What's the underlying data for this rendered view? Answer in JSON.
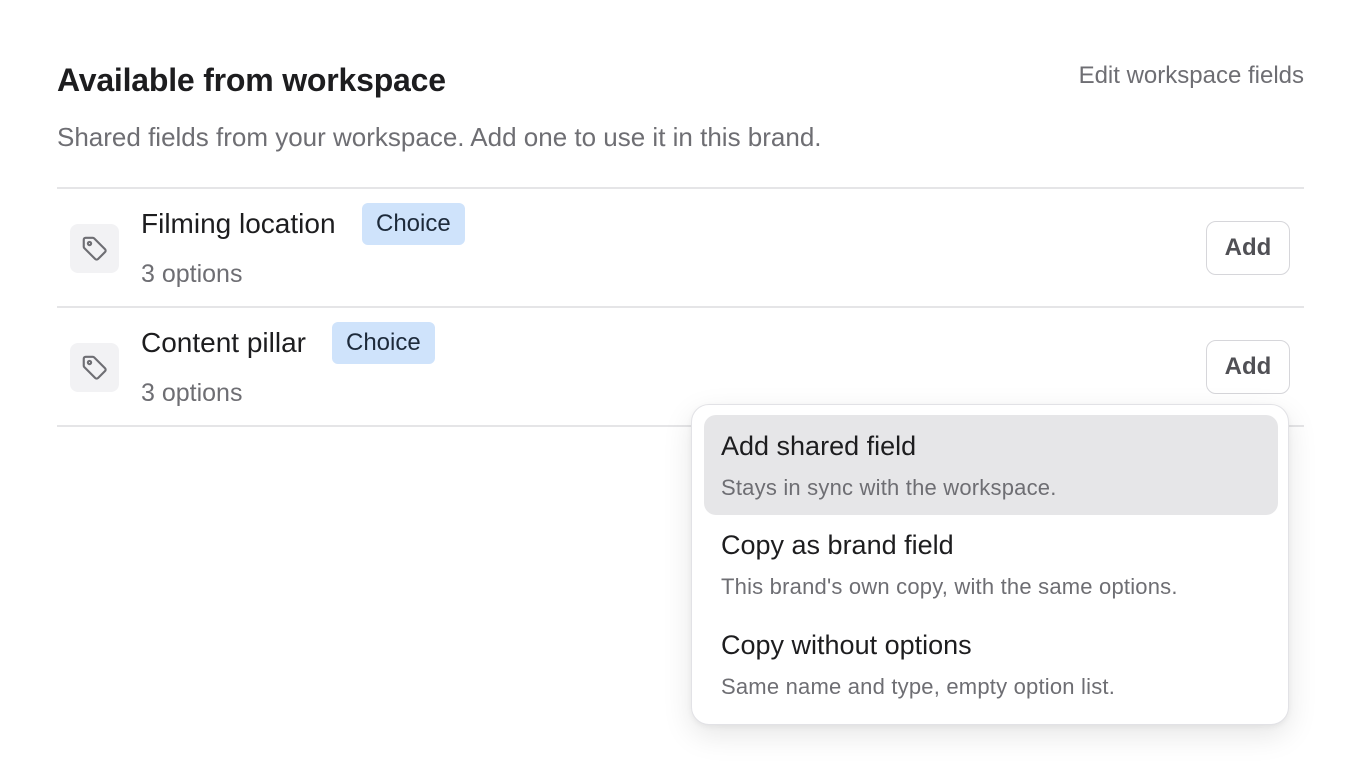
{
  "header": {
    "title": "Available from workspace",
    "edit_link": "Edit workspace fields",
    "subtitle": "Shared fields from your workspace. Add one to use it in this brand."
  },
  "fields": [
    {
      "name": "Filming location",
      "type_badge": "Choice",
      "meta": "3 options",
      "icon": "tag-icon",
      "add_label": "Add"
    },
    {
      "name": "Content pillar",
      "type_badge": "Choice",
      "meta": "3 options",
      "icon": "tag-icon",
      "add_label": "Add"
    }
  ],
  "add_menu": {
    "items": [
      {
        "title": "Add shared field",
        "description": "Stays in sync with the workspace.",
        "highlighted": true
      },
      {
        "title": "Copy as brand field",
        "description": "This brand's own copy, with the same options.",
        "highlighted": false
      },
      {
        "title": "Copy without options",
        "description": "Same name and type, empty option list.",
        "highlighted": false
      }
    ]
  },
  "colors": {
    "badge_bg": "#cfe3fb",
    "highlight_bg": "#e6e6e8",
    "muted_text": "#6e6e73"
  }
}
